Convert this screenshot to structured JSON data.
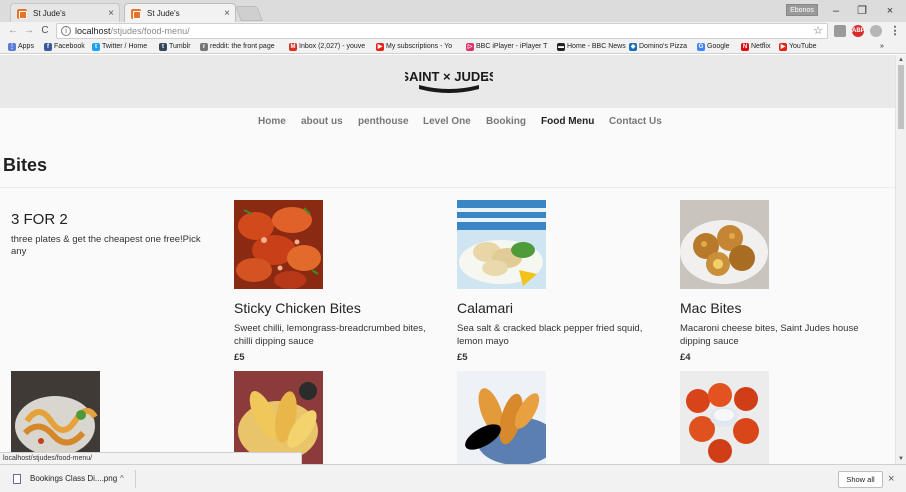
{
  "browser": {
    "tabs": [
      {
        "title": "St Jude's",
        "close": "×"
      },
      {
        "title": "St Jude's",
        "close": "×"
      }
    ],
    "user_badge": "Ebonos",
    "window_controls": {
      "minimize": "–",
      "restore": "❐",
      "close": "×"
    },
    "nav": {
      "back": "←",
      "forward": "→",
      "reload": "C",
      "info": "i"
    },
    "url": {
      "host": "localhost",
      "path": "/stjudes/food-menu/"
    },
    "bookmark_star": "☆",
    "extensions": [
      {
        "icon": "document-icon",
        "label": "",
        "color": "#8a8a8a"
      },
      {
        "icon": "adblock-icon",
        "label": "ABP",
        "color": "#d62b2b"
      },
      {
        "icon": "shield-icon",
        "label": "",
        "color": "#a5a5a5"
      },
      {
        "icon": "menu-dots-icon",
        "label": "⋮",
        "color": "#555555"
      }
    ],
    "bookmarks": [
      {
        "label": "Apps",
        "icon": "apps-icon",
        "color": "#5a7bd6",
        "glyph": "⋮"
      },
      {
        "label": "Facebook",
        "icon": "facebook-icon",
        "color": "#3b5998",
        "glyph": "f"
      },
      {
        "label": "Twitter / Home",
        "icon": "twitter-icon",
        "color": "#1da1f2",
        "glyph": "t"
      },
      {
        "label": "Tumblr",
        "icon": "tumblr-icon",
        "color": "#35465c",
        "glyph": "t"
      },
      {
        "label": "reddit: the front page",
        "icon": "reddit-icon",
        "color": "#777777",
        "glyph": "r"
      },
      {
        "label": "Inbox (2,027) - youve",
        "icon": "gmail-icon",
        "color": "#d93025",
        "glyph": "M"
      },
      {
        "label": "My subscriptions - Yo",
        "icon": "youtube-icon",
        "color": "#e62117",
        "glyph": "▶"
      },
      {
        "label": "BBC iPlayer - iPlayer T",
        "icon": "iplayer-icon",
        "color": "#e0316f",
        "glyph": "▷"
      },
      {
        "label": "Home - BBC News",
        "icon": "bbc-icon",
        "color": "#222222",
        "glyph": "▬"
      },
      {
        "label": "Domino's Pizza",
        "icon": "dominos-icon",
        "color": "#1a6fb5",
        "glyph": "◆"
      },
      {
        "label": "Google",
        "icon": "google-icon",
        "color": "#4285f4",
        "glyph": "G"
      },
      {
        "label": "Netflix",
        "icon": "netflix-icon",
        "color": "#e50914",
        "glyph": "N"
      },
      {
        "label": "YouTube",
        "icon": "youtube-icon",
        "color": "#e62117",
        "glyph": "▶"
      }
    ],
    "more_bookmarks": "»",
    "scrollbar": {
      "up": "▲",
      "down": "▼"
    },
    "status_url": "localhost/stjudes/food-menu/",
    "download": {
      "filename": "Bookings Class Di....png",
      "caret": "^",
      "show_all": "Show all",
      "close": "×"
    }
  },
  "site": {
    "logo_text": "SAINT × JUDES",
    "nav": [
      "Home",
      "about us",
      "penthouse",
      "Level One",
      "Booking",
      "Food Menu",
      "Contact Us"
    ],
    "active_nav": "Food Menu",
    "section_title": "Bites",
    "promo": {
      "title": "3 FOR 2",
      "description": "three plates & get the cheapest one free!Pick any"
    },
    "items": [
      {
        "name": "Sticky Chicken Bites",
        "description": "Sweet chilli, lemongrass-breadcrumbed bites, chilli dipping sauce",
        "price": "£5",
        "photo": "sticky-chicken-photo"
      },
      {
        "name": "Calamari",
        "description": "Sea salt & cracked black pepper fried squid, lemon mayo",
        "price": "£5",
        "photo": "calamari-photo"
      },
      {
        "name": "Mac Bites",
        "description": "Macaroni cheese bites, Saint Judes house dipping sauce",
        "price": "£4",
        "photo": "mac-bites-photo"
      }
    ],
    "next_row_photos": [
      "crispy-noodles-photo",
      "tempura-prawns-photo",
      "chicken-goujons-photo",
      "buffalo-bites-photo"
    ]
  }
}
